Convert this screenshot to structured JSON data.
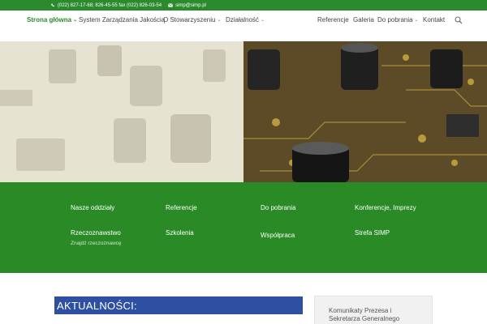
{
  "topbar": {
    "phone": "(022) 827-17-68; 826-45-55 fax (022) 826-03-54",
    "email": "simp@simp.pl"
  },
  "nav": {
    "items": [
      {
        "label": "Strona główna",
        "has_dropdown": true,
        "active": true
      },
      {
        "label": "System Zarządzania Jakością",
        "has_dropdown": false,
        "active": false
      },
      {
        "label": "O Stowarzyszeniu",
        "has_dropdown": true,
        "active": false
      },
      {
        "label": "Działalność",
        "has_dropdown": true,
        "active": false
      },
      {
        "label": "Referencje",
        "has_dropdown": false,
        "active": false
      },
      {
        "label": "Galeria",
        "has_dropdown": false,
        "active": false
      },
      {
        "label": "Do pobrania",
        "has_dropdown": true,
        "active": false
      },
      {
        "label": "Kontakt",
        "has_dropdown": false,
        "active": false
      }
    ],
    "search_icon": "search-icon"
  },
  "links": {
    "nasze_oddzialy": "Nasze oddziały",
    "referencje": "Referencje",
    "do_pobrania": "Do pobrania",
    "konferencje": "Konferencje, Imprezy",
    "rzeczoznawstwo": "Rzeczoznawstwo",
    "znajdz": "Znajdź rzeczoznawcę",
    "szkolenia": "Szkolenia",
    "wspolpraca": "Współpraca",
    "strefa": "Strefa SIMP"
  },
  "news": {
    "title": "AKTUALNOŚCI:"
  },
  "sidebar": {
    "box_title_line1": "Komunikaty Prezesa i",
    "box_title_line2": "Sekretarza Generalnego"
  },
  "colors": {
    "brand_green": "#2a8a25",
    "news_blue": "#2d50a3"
  }
}
